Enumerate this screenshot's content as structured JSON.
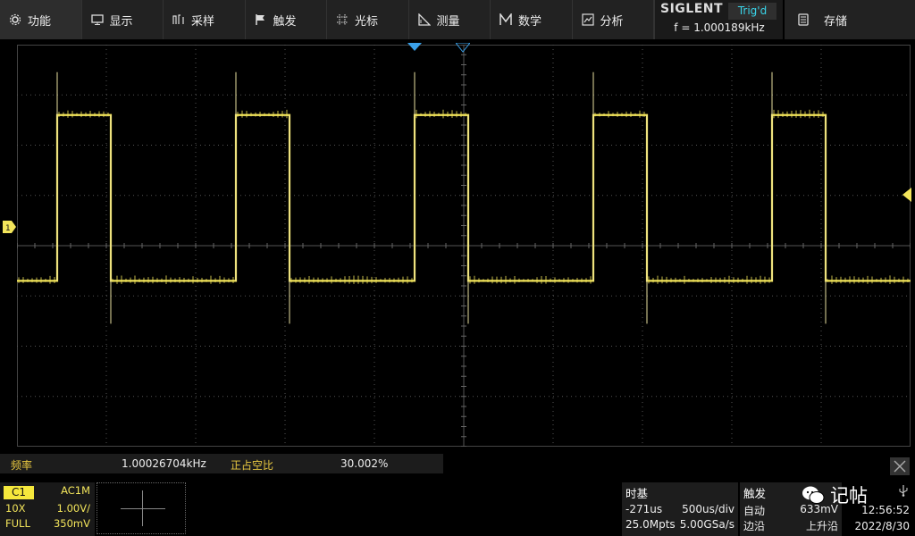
{
  "menu": {
    "items": [
      {
        "label": "功能",
        "icon": "gear-icon"
      },
      {
        "label": "显示",
        "icon": "monitor-icon"
      },
      {
        "label": "采样",
        "icon": "sample-icon"
      },
      {
        "label": "触发",
        "icon": "flag-icon"
      },
      {
        "label": "光标",
        "icon": "cursor-icon"
      },
      {
        "label": "测量",
        "icon": "ruler-icon"
      },
      {
        "label": "数学",
        "icon": "math-icon"
      },
      {
        "label": "分析",
        "icon": "analysis-icon"
      }
    ]
  },
  "brand": {
    "logo": "SIGLENT",
    "trig_status": "Trig'd",
    "frequency": "f = 1.000189kHz"
  },
  "save": {
    "label": "存储",
    "icon": "save-icon"
  },
  "measurements": {
    "freq_label": "频率",
    "freq_value": "1.00026704kHz",
    "duty_label": "正占空比",
    "duty_value": "30.002%"
  },
  "channel": {
    "name": "C1",
    "coupling": "AC1M",
    "probe": "10X",
    "scale": "1.00V/",
    "bandwidth": "FULL",
    "offset": "350mV"
  },
  "timebase": {
    "title": "时基",
    "delay": "-271us",
    "scale": "500us/div",
    "memory": "25.0Mpts",
    "sample_rate": "5.00GSa/s"
  },
  "trigger": {
    "title": "触发",
    "mode": "自动",
    "level": "633mV",
    "type": "边沿",
    "slope": "上升沿"
  },
  "clock": {
    "time": "12:56:52",
    "date": "2022/8/30"
  },
  "watermark": {
    "text": "记帖"
  },
  "colors": {
    "trace": "#f3e55b",
    "trigger_marker": "#3aa0e8",
    "status_cyan": "#39d3e8",
    "panel_bg": "#222222"
  },
  "waveform": {
    "period_div": 2.0,
    "duty": 0.3,
    "high_div": -2.6,
    "low_div": 0.7,
    "first_rise_div": 0.45
  }
}
